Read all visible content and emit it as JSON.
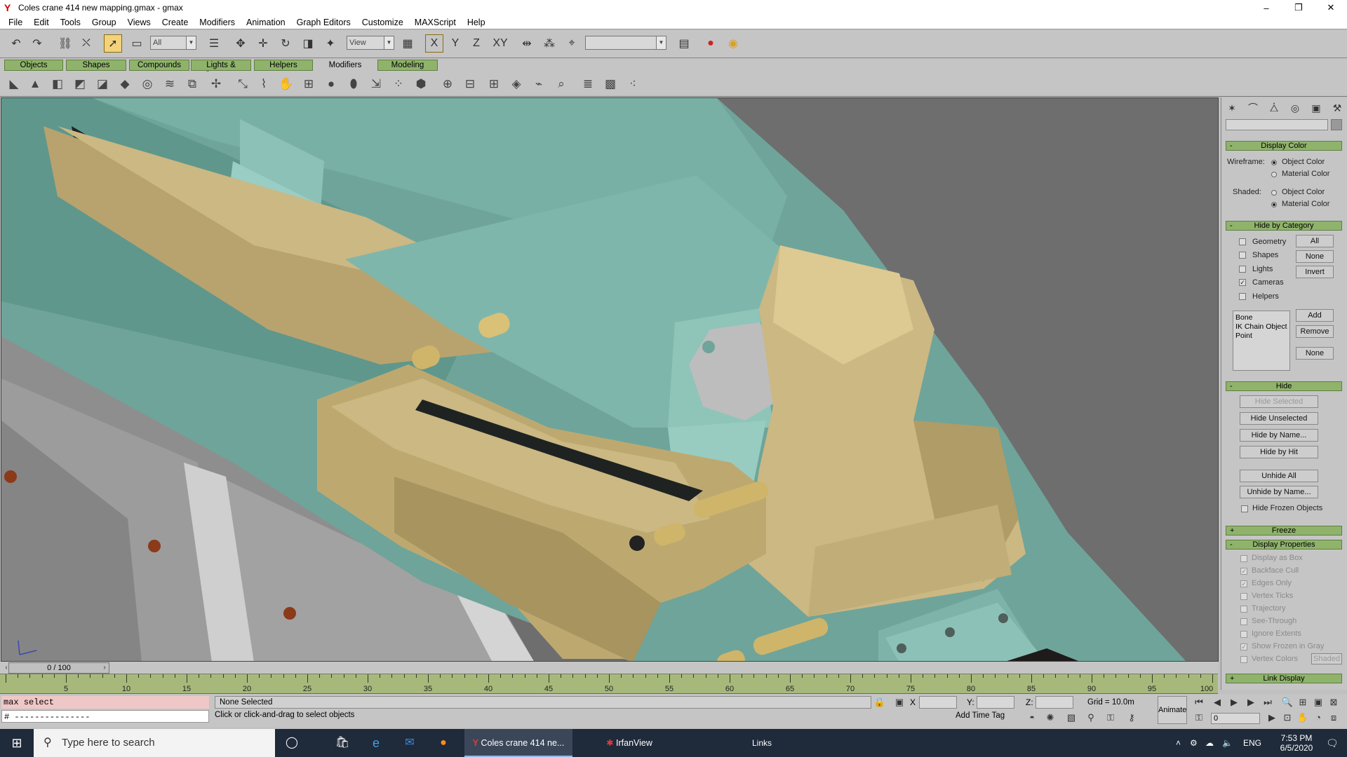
{
  "window": {
    "title": "Coles crane 414 new mapping.gmax - gmax",
    "minimize": "–",
    "maximize": "❐",
    "close": "✕"
  },
  "menu": [
    "File",
    "Edit",
    "Tools",
    "Group",
    "Views",
    "Create",
    "Modifiers",
    "Animation",
    "Graph Editors",
    "Customize",
    "MAXScript",
    "Help"
  ],
  "toolbar": {
    "selection_filter": "All",
    "reference_coord": "View",
    "axis_x": "X",
    "axis_y": "Y",
    "axis_z": "Z",
    "axis_xy": "XY",
    "named_selection": ""
  },
  "tabs": [
    "Objects",
    "Shapes",
    "Compounds",
    "Lights & Cameras",
    "Helpers",
    "Modifiers",
    "Modeling"
  ],
  "selected_tab": "Modifiers",
  "command_panel": {
    "display_color": {
      "title": "Display Color",
      "wireframe_label": "Wireframe:",
      "shaded_label": "Shaded:",
      "object_color": "Object Color",
      "material_color": "Material Color",
      "wireframe_selected": "Object Color",
      "shaded_selected": "Material Color"
    },
    "hide_by_category": {
      "title": "Hide by Category",
      "items": [
        {
          "label": "Geometry",
          "checked": false
        },
        {
          "label": "Shapes",
          "checked": false
        },
        {
          "label": "Lights",
          "checked": false
        },
        {
          "label": "Cameras",
          "checked": true
        },
        {
          "label": "Helpers",
          "checked": false
        }
      ],
      "all_btn": "All",
      "none_btn": "None",
      "invert_btn": "Invert",
      "list": [
        "Bone",
        "IK Chain Object",
        "Point"
      ],
      "add_btn": "Add",
      "remove_btn": "Remove",
      "none2_btn": "None"
    },
    "hide": {
      "title": "Hide",
      "hide_selected": "Hide Selected",
      "hide_unselected": "Hide Unselected",
      "hide_by_name": "Hide by Name...",
      "hide_by_hit": "Hide by Hit",
      "unhide_all": "Unhide All",
      "unhide_by_name": "Unhide by Name...",
      "hide_frozen": "Hide Frozen Objects"
    },
    "freeze": {
      "title": "Freeze"
    },
    "display_properties": {
      "title": "Display Properties",
      "items": [
        {
          "label": "Display as Box",
          "checked": false
        },
        {
          "label": "Backface Cull",
          "checked": true
        },
        {
          "label": "Edges Only",
          "checked": true
        },
        {
          "label": "Vertex Ticks",
          "checked": false
        },
        {
          "label": "Trajectory",
          "checked": false
        },
        {
          "label": "See-Through",
          "checked": false
        },
        {
          "label": "Ignore Extents",
          "checked": false
        },
        {
          "label": "Show Frozen in Gray",
          "checked": true
        },
        {
          "label": "Vertex Colors",
          "checked": false
        }
      ],
      "shaded_btn": "Shaded"
    },
    "link_display": {
      "title": "Link Display"
    }
  },
  "timeline": {
    "frame_slider": "0 / 100",
    "ticks": [
      5,
      10,
      15,
      20,
      25,
      30,
      35,
      40,
      45,
      50,
      55,
      60,
      65,
      70,
      75,
      80,
      85,
      90,
      95,
      100
    ]
  },
  "status": {
    "listener_line1": "max select",
    "listener_line2": "# ---------------",
    "selection": "None Selected",
    "prompt": "Click or click-and-drag to select objects",
    "x_label": "X",
    "y_label": "Y:",
    "z_label": "Z:",
    "grid": "Grid = 10.0m",
    "add_time_tag": "Add Time Tag",
    "animate": "Animate",
    "current_frame": "0"
  },
  "taskbar": {
    "search_placeholder": "Type here to search",
    "app1": "Coles crane 414 ne...",
    "app2": "IrfanView",
    "links": "Links",
    "lang": "ENG",
    "time": "7:53 PM",
    "date": "6/5/2020"
  },
  "colors": {
    "rollout_green": "#8fb36b",
    "trackbar_green": "#a6b97b",
    "teal_model": "#6fa49a",
    "gold_model": "#c4b27a",
    "viewport_bg": "#6e6e6e"
  }
}
